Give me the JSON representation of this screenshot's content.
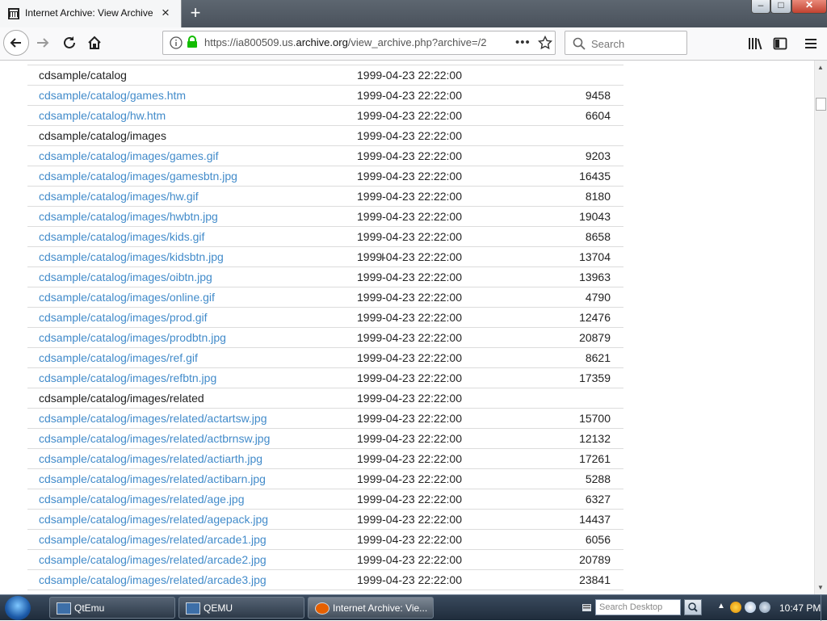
{
  "browser": {
    "tab_title": "Internet Archive: View Archive",
    "close_tab_glyph": "×",
    "new_tab_glyph": "+",
    "url_prefix": "https://ia800509.us.",
    "url_domain": "archive.org",
    "url_rest": "/view_archive.php?archive=/2",
    "page_actions_glyph": "•••",
    "search_placeholder": "Search"
  },
  "rows": [
    {
      "name": "cdsample/catalog",
      "is_link": false,
      "date": "1999-04-23 22:22:00",
      "size": ""
    },
    {
      "name": "cdsample/catalog/games.htm",
      "is_link": true,
      "date": "1999-04-23 22:22:00",
      "size": "9458"
    },
    {
      "name": "cdsample/catalog/hw.htm",
      "is_link": true,
      "date": "1999-04-23 22:22:00",
      "size": "6604"
    },
    {
      "name": "cdsample/catalog/images",
      "is_link": false,
      "date": "1999-04-23 22:22:00",
      "size": ""
    },
    {
      "name": "cdsample/catalog/images/games.gif",
      "is_link": true,
      "date": "1999-04-23 22:22:00",
      "size": "9203"
    },
    {
      "name": "cdsample/catalog/images/gamesbtn.jpg",
      "is_link": true,
      "date": "1999-04-23 22:22:00",
      "size": "16435"
    },
    {
      "name": "cdsample/catalog/images/hw.gif",
      "is_link": true,
      "date": "1999-04-23 22:22:00",
      "size": "8180"
    },
    {
      "name": "cdsample/catalog/images/hwbtn.jpg",
      "is_link": true,
      "date": "1999-04-23 22:22:00",
      "size": "19043"
    },
    {
      "name": "cdsample/catalog/images/kids.gif",
      "is_link": true,
      "date": "1999-04-23 22:22:00",
      "size": "8658"
    },
    {
      "name": "cdsample/catalog/images/kidsbtn.jpg",
      "is_link": true,
      "date": "1999-04-23 22:22:00",
      "size": "13704"
    },
    {
      "name": "cdsample/catalog/images/oibtn.jpg",
      "is_link": true,
      "date": "1999-04-23 22:22:00",
      "size": "13963"
    },
    {
      "name": "cdsample/catalog/images/online.gif",
      "is_link": true,
      "date": "1999-04-23 22:22:00",
      "size": "4790"
    },
    {
      "name": "cdsample/catalog/images/prod.gif",
      "is_link": true,
      "date": "1999-04-23 22:22:00",
      "size": "12476"
    },
    {
      "name": "cdsample/catalog/images/prodbtn.jpg",
      "is_link": true,
      "date": "1999-04-23 22:22:00",
      "size": "20879"
    },
    {
      "name": "cdsample/catalog/images/ref.gif",
      "is_link": true,
      "date": "1999-04-23 22:22:00",
      "size": "8621"
    },
    {
      "name": "cdsample/catalog/images/refbtn.jpg",
      "is_link": true,
      "date": "1999-04-23 22:22:00",
      "size": "17359"
    },
    {
      "name": "cdsample/catalog/images/related",
      "is_link": false,
      "date": "1999-04-23 22:22:00",
      "size": ""
    },
    {
      "name": "cdsample/catalog/images/related/actartsw.jpg",
      "is_link": true,
      "date": "1999-04-23 22:22:00",
      "size": "15700"
    },
    {
      "name": "cdsample/catalog/images/related/actbrnsw.jpg",
      "is_link": true,
      "date": "1999-04-23 22:22:00",
      "size": "12132"
    },
    {
      "name": "cdsample/catalog/images/related/actiarth.jpg",
      "is_link": true,
      "date": "1999-04-23 22:22:00",
      "size": "17261"
    },
    {
      "name": "cdsample/catalog/images/related/actibarn.jpg",
      "is_link": true,
      "date": "1999-04-23 22:22:00",
      "size": "5288"
    },
    {
      "name": "cdsample/catalog/images/related/age.jpg",
      "is_link": true,
      "date": "1999-04-23 22:22:00",
      "size": "6327"
    },
    {
      "name": "cdsample/catalog/images/related/agepack.jpg",
      "is_link": true,
      "date": "1999-04-23 22:22:00",
      "size": "14437"
    },
    {
      "name": "cdsample/catalog/images/related/arcade1.jpg",
      "is_link": true,
      "date": "1999-04-23 22:22:00",
      "size": "6056"
    },
    {
      "name": "cdsample/catalog/images/related/arcade2.jpg",
      "is_link": true,
      "date": "1999-04-23 22:22:00",
      "size": "20789"
    },
    {
      "name": "cdsample/catalog/images/related/arcade3.jpg",
      "is_link": true,
      "date": "1999-04-23 22:22:00",
      "size": "23841"
    }
  ],
  "taskbar": {
    "buttons": [
      {
        "label": "QtEmu"
      },
      {
        "label": "QEMU"
      },
      {
        "label": "Internet Archive: Vie..."
      }
    ],
    "desktop_search_placeholder": "Search Desktop",
    "clock": "10:47 PM"
  },
  "colors": {
    "link": "#428bca",
    "row_border": "#dcdcdc"
  }
}
